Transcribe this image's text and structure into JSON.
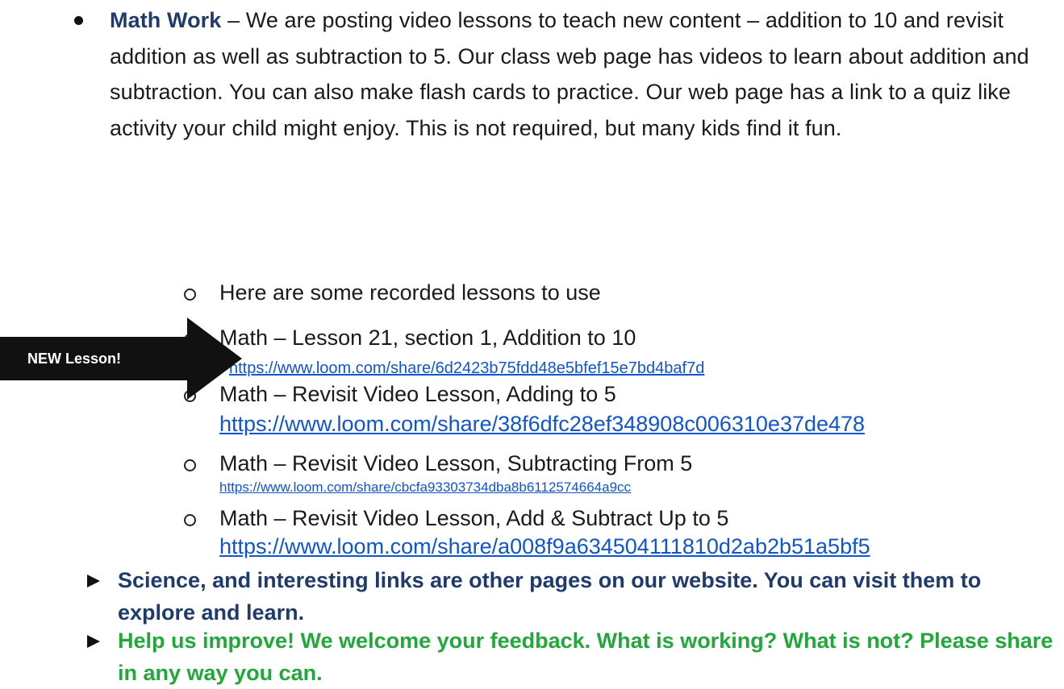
{
  "math_bullet": {
    "lead": "Math Work",
    "body": " – We are posting video lessons to teach new content – addition to 10 and revisit addition as well as subtraction to 5.  Our class web page has videos to learn about addition and subtraction. You can also make flash cards to practice. Our web page has a link to a quiz like activity your child might enjoy.  This is not required, but many kids find it fun."
  },
  "sub_items": [
    {
      "text": "Here are some recorded lessons to use"
    },
    {
      "text": "Math – Lesson 21, section 1, Addition to 10",
      "link": "https://www.loom.com/share/6d2423b75fdd48e5bfef15e7bd4baf7d"
    },
    {
      "text": "Math – Revisit Video Lesson, Adding to 5",
      "link": "https://www.loom.com/share/38f6dfc28ef348908c006310e37de478"
    },
    {
      "text": "Math – Revisit Video Lesson, Subtracting From 5",
      "link": "https://www.loom.com/share/cbcfa93303734dba8b6112574664a9cc"
    },
    {
      "text": "Math – Revisit Video Lesson, Add & Subtract Up to 5",
      "link": "https://www.loom.com/share/a008f9a634504111810d2ab2b51a5bf5"
    }
  ],
  "callout": {
    "label": "NEW Lesson!"
  },
  "science_bullet": {
    "text": "Science, and interesting links are other pages on our website.  You can visit them to explore and learn."
  },
  "feedback_bullet": {
    "text": "Help us improve! We welcome your feedback.  What is working?  What is not? Please share in any way you can."
  },
  "colors": {
    "navy": "#1f3b6e",
    "green": "#22a83a",
    "link": "#1155cc",
    "arrow": "#111111"
  },
  "icons": [
    "bullet-dot-icon",
    "hollow-circle-icon",
    "arrow-callout-icon",
    "arrowhead-bullet-icon"
  ]
}
